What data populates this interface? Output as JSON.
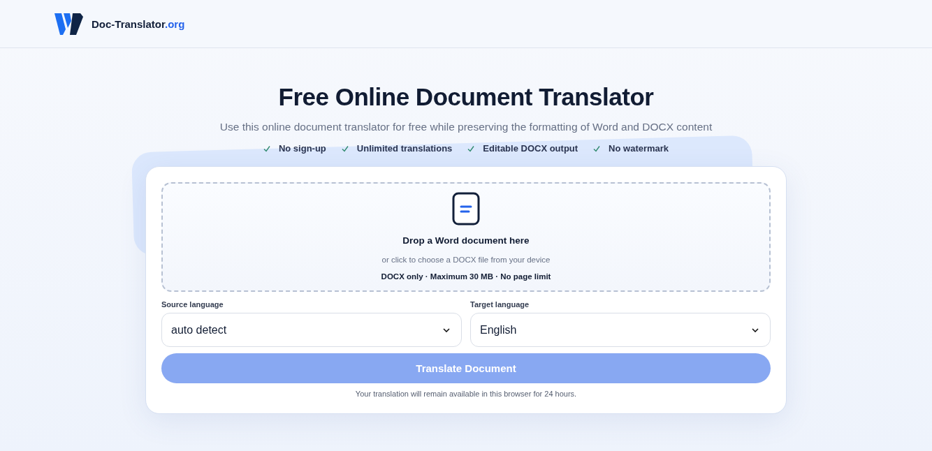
{
  "header": {
    "brand_name": "Doc-Translator",
    "brand_suffix": ".org"
  },
  "hero": {
    "title": "Free Online Document Translator",
    "subtitle": "Use this online document translator for free while preserving the formatting of Word and DOCX content",
    "features": [
      {
        "label": "No sign-up"
      },
      {
        "label": "Unlimited translations"
      },
      {
        "label": "Editable DOCX output"
      },
      {
        "label": "No watermark"
      }
    ]
  },
  "dropzone": {
    "title": "Drop a Word document here",
    "hint": "or click to choose a DOCX file from your device",
    "limits": "DOCX only · Maximum 30 MB · No page limit"
  },
  "languages": [
    {
      "label": "Source language",
      "value": "auto detect"
    },
    {
      "label": "Target language",
      "value": "English"
    }
  ],
  "translate_button": {
    "label": "Translate Document",
    "disabled": true
  },
  "note": "Your translation will remain available in this browser for 24 hours."
}
